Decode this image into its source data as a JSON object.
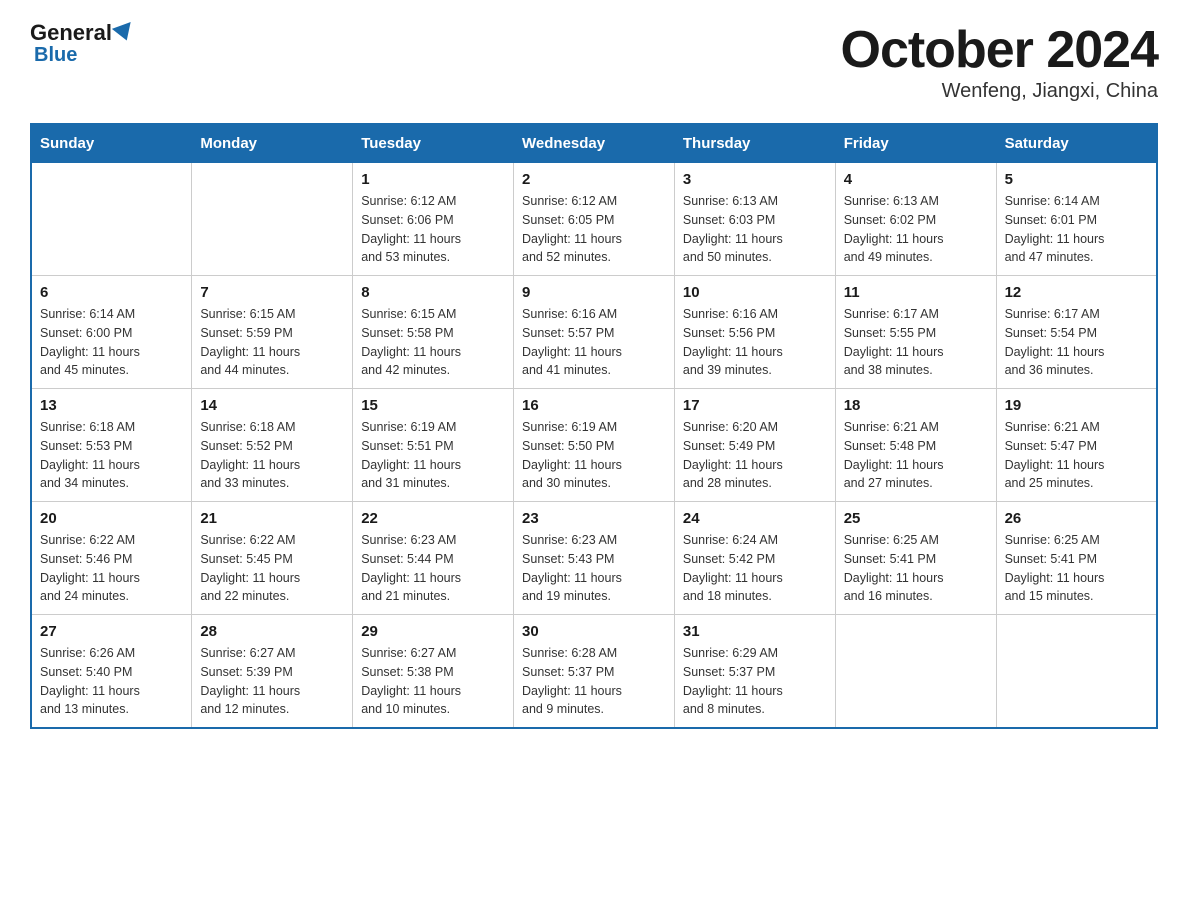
{
  "header": {
    "logo_general": "General",
    "logo_blue": "Blue",
    "title": "October 2024",
    "subtitle": "Wenfeng, Jiangxi, China"
  },
  "days_of_week": [
    "Sunday",
    "Monday",
    "Tuesday",
    "Wednesday",
    "Thursday",
    "Friday",
    "Saturday"
  ],
  "weeks": [
    [
      {
        "num": "",
        "info": ""
      },
      {
        "num": "",
        "info": ""
      },
      {
        "num": "1",
        "info": "Sunrise: 6:12 AM\nSunset: 6:06 PM\nDaylight: 11 hours\nand 53 minutes."
      },
      {
        "num": "2",
        "info": "Sunrise: 6:12 AM\nSunset: 6:05 PM\nDaylight: 11 hours\nand 52 minutes."
      },
      {
        "num": "3",
        "info": "Sunrise: 6:13 AM\nSunset: 6:03 PM\nDaylight: 11 hours\nand 50 minutes."
      },
      {
        "num": "4",
        "info": "Sunrise: 6:13 AM\nSunset: 6:02 PM\nDaylight: 11 hours\nand 49 minutes."
      },
      {
        "num": "5",
        "info": "Sunrise: 6:14 AM\nSunset: 6:01 PM\nDaylight: 11 hours\nand 47 minutes."
      }
    ],
    [
      {
        "num": "6",
        "info": "Sunrise: 6:14 AM\nSunset: 6:00 PM\nDaylight: 11 hours\nand 45 minutes."
      },
      {
        "num": "7",
        "info": "Sunrise: 6:15 AM\nSunset: 5:59 PM\nDaylight: 11 hours\nand 44 minutes."
      },
      {
        "num": "8",
        "info": "Sunrise: 6:15 AM\nSunset: 5:58 PM\nDaylight: 11 hours\nand 42 minutes."
      },
      {
        "num": "9",
        "info": "Sunrise: 6:16 AM\nSunset: 5:57 PM\nDaylight: 11 hours\nand 41 minutes."
      },
      {
        "num": "10",
        "info": "Sunrise: 6:16 AM\nSunset: 5:56 PM\nDaylight: 11 hours\nand 39 minutes."
      },
      {
        "num": "11",
        "info": "Sunrise: 6:17 AM\nSunset: 5:55 PM\nDaylight: 11 hours\nand 38 minutes."
      },
      {
        "num": "12",
        "info": "Sunrise: 6:17 AM\nSunset: 5:54 PM\nDaylight: 11 hours\nand 36 minutes."
      }
    ],
    [
      {
        "num": "13",
        "info": "Sunrise: 6:18 AM\nSunset: 5:53 PM\nDaylight: 11 hours\nand 34 minutes."
      },
      {
        "num": "14",
        "info": "Sunrise: 6:18 AM\nSunset: 5:52 PM\nDaylight: 11 hours\nand 33 minutes."
      },
      {
        "num": "15",
        "info": "Sunrise: 6:19 AM\nSunset: 5:51 PM\nDaylight: 11 hours\nand 31 minutes."
      },
      {
        "num": "16",
        "info": "Sunrise: 6:19 AM\nSunset: 5:50 PM\nDaylight: 11 hours\nand 30 minutes."
      },
      {
        "num": "17",
        "info": "Sunrise: 6:20 AM\nSunset: 5:49 PM\nDaylight: 11 hours\nand 28 minutes."
      },
      {
        "num": "18",
        "info": "Sunrise: 6:21 AM\nSunset: 5:48 PM\nDaylight: 11 hours\nand 27 minutes."
      },
      {
        "num": "19",
        "info": "Sunrise: 6:21 AM\nSunset: 5:47 PM\nDaylight: 11 hours\nand 25 minutes."
      }
    ],
    [
      {
        "num": "20",
        "info": "Sunrise: 6:22 AM\nSunset: 5:46 PM\nDaylight: 11 hours\nand 24 minutes."
      },
      {
        "num": "21",
        "info": "Sunrise: 6:22 AM\nSunset: 5:45 PM\nDaylight: 11 hours\nand 22 minutes."
      },
      {
        "num": "22",
        "info": "Sunrise: 6:23 AM\nSunset: 5:44 PM\nDaylight: 11 hours\nand 21 minutes."
      },
      {
        "num": "23",
        "info": "Sunrise: 6:23 AM\nSunset: 5:43 PM\nDaylight: 11 hours\nand 19 minutes."
      },
      {
        "num": "24",
        "info": "Sunrise: 6:24 AM\nSunset: 5:42 PM\nDaylight: 11 hours\nand 18 minutes."
      },
      {
        "num": "25",
        "info": "Sunrise: 6:25 AM\nSunset: 5:41 PM\nDaylight: 11 hours\nand 16 minutes."
      },
      {
        "num": "26",
        "info": "Sunrise: 6:25 AM\nSunset: 5:41 PM\nDaylight: 11 hours\nand 15 minutes."
      }
    ],
    [
      {
        "num": "27",
        "info": "Sunrise: 6:26 AM\nSunset: 5:40 PM\nDaylight: 11 hours\nand 13 minutes."
      },
      {
        "num": "28",
        "info": "Sunrise: 6:27 AM\nSunset: 5:39 PM\nDaylight: 11 hours\nand 12 minutes."
      },
      {
        "num": "29",
        "info": "Sunrise: 6:27 AM\nSunset: 5:38 PM\nDaylight: 11 hours\nand 10 minutes."
      },
      {
        "num": "30",
        "info": "Sunrise: 6:28 AM\nSunset: 5:37 PM\nDaylight: 11 hours\nand 9 minutes."
      },
      {
        "num": "31",
        "info": "Sunrise: 6:29 AM\nSunset: 5:37 PM\nDaylight: 11 hours\nand 8 minutes."
      },
      {
        "num": "",
        "info": ""
      },
      {
        "num": "",
        "info": ""
      }
    ]
  ]
}
